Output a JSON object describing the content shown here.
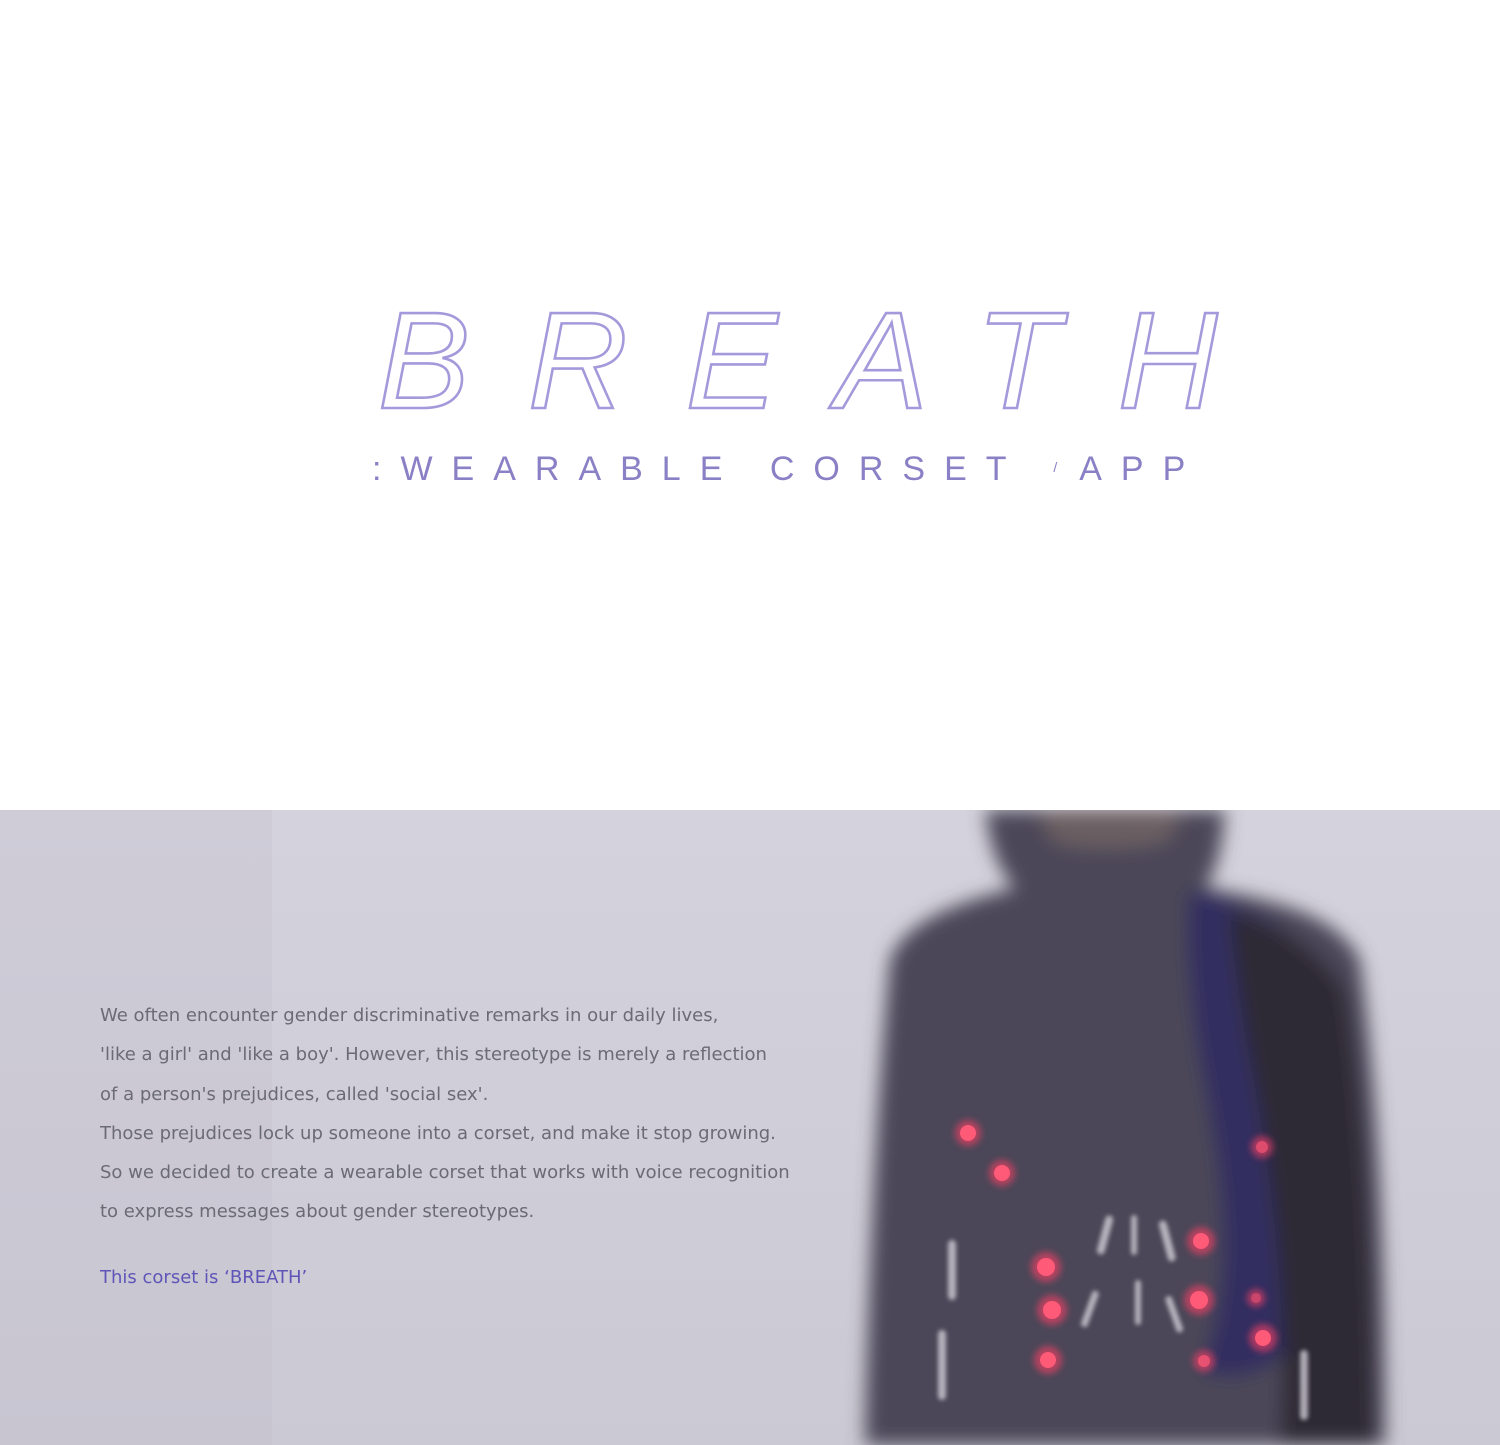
{
  "hero": {
    "title": "BREATH",
    "subtitle": {
      "prefix": ":",
      "part1": "WEARABLE CORSET",
      "separator": "/",
      "part2": "APP"
    }
  },
  "story": {
    "lines": [
      "We often encounter gender discriminative remarks in our daily lives,",
      "'like a girl' and 'like a boy'. However, this stereotype is merely a reflection",
      "of a person's prejudices, called 'social sex'.",
      "Those prejudices lock up someone into a corset, and make it stop growing.",
      "So we decided to create a wearable corset that works with voice recognition",
      "to express messages about gender stereotypes."
    ],
    "tagline": "This corset is ‘BREATH’"
  },
  "colors": {
    "accent": "#a49adb",
    "subtitle": "#8a80c6",
    "tagline": "#5f55b8",
    "body_text": "#6b6b76",
    "led": "#ff4a6a"
  },
  "icons": {
    "led_lights": "led-light-icon"
  }
}
